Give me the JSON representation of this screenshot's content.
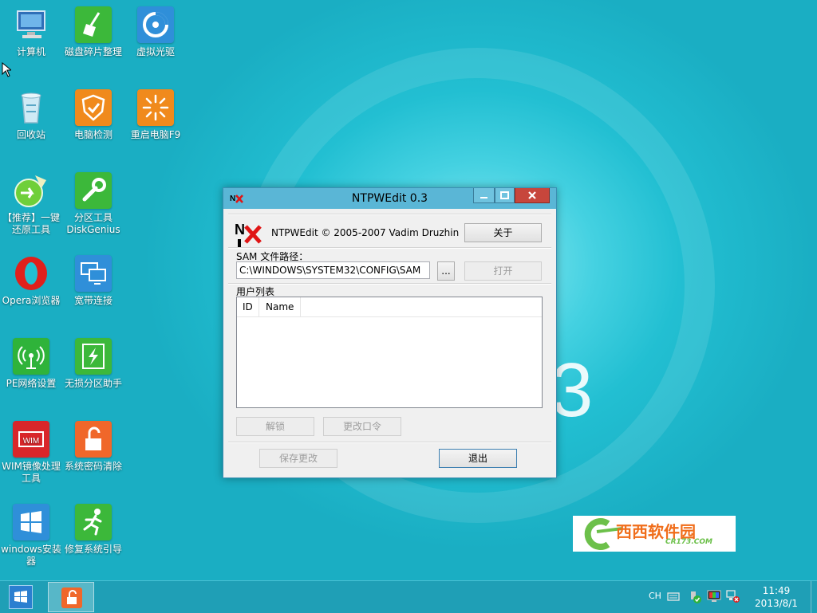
{
  "desktop_icons": [
    {
      "id": "computer",
      "label": "计算机"
    },
    {
      "id": "disk-defrag",
      "label": "磁盘碎片整理"
    },
    {
      "id": "virtual-drive",
      "label": "虚拟光驱"
    },
    {
      "id": "recycle-bin",
      "label": "回收站"
    },
    {
      "id": "pc-check",
      "label": "电脑检测"
    },
    {
      "id": "restart-f9",
      "label": "重启电脑F9"
    },
    {
      "id": "one-key-restore",
      "label": "【推荐】一键还原工具"
    },
    {
      "id": "diskgenius",
      "label": "分区工具DiskGenius"
    },
    {
      "id": "opera",
      "label": "Opera浏览器"
    },
    {
      "id": "broadband",
      "label": "宽带连接"
    },
    {
      "id": "pe-network",
      "label": "PE网络设置"
    },
    {
      "id": "lossless-partition",
      "label": "无损分区助手"
    },
    {
      "id": "wim-tool",
      "label": "WIM镜像处理工具"
    },
    {
      "id": "password-clear",
      "label": "系统密码清除"
    },
    {
      "id": "windows-install",
      "label": "windows安装器"
    },
    {
      "id": "boot-repair",
      "label": "修复系统引导"
    }
  ],
  "window": {
    "title": "NTPWEdit 0.3",
    "copyright": "NTPWEdit © 2005-2007 Vadim Druzhin",
    "about_label": "关于",
    "sam_label": "SAM 文件路径：",
    "sam_path": "C:\\WINDOWS\\SYSTEM32\\CONFIG\\SAM",
    "browse_label": "...",
    "open_label": "打开",
    "user_list_label": "用户列表",
    "columns": [
      "ID",
      "Name"
    ],
    "unlock_label": "解锁",
    "change_password_label": "更改口令",
    "save_label": "保存更改",
    "exit_label": "退出"
  },
  "watermark": {
    "brand": "西西软件园",
    "site": "CR173.COM"
  },
  "tray": {
    "lang": "CH",
    "time": "11:49",
    "date": "2013/8/1"
  },
  "colors": {
    "desktop": "#22bfd2",
    "taskbar": "#1f9fb6",
    "titlebar": "#5ab6d6",
    "close": "#c7463c"
  }
}
